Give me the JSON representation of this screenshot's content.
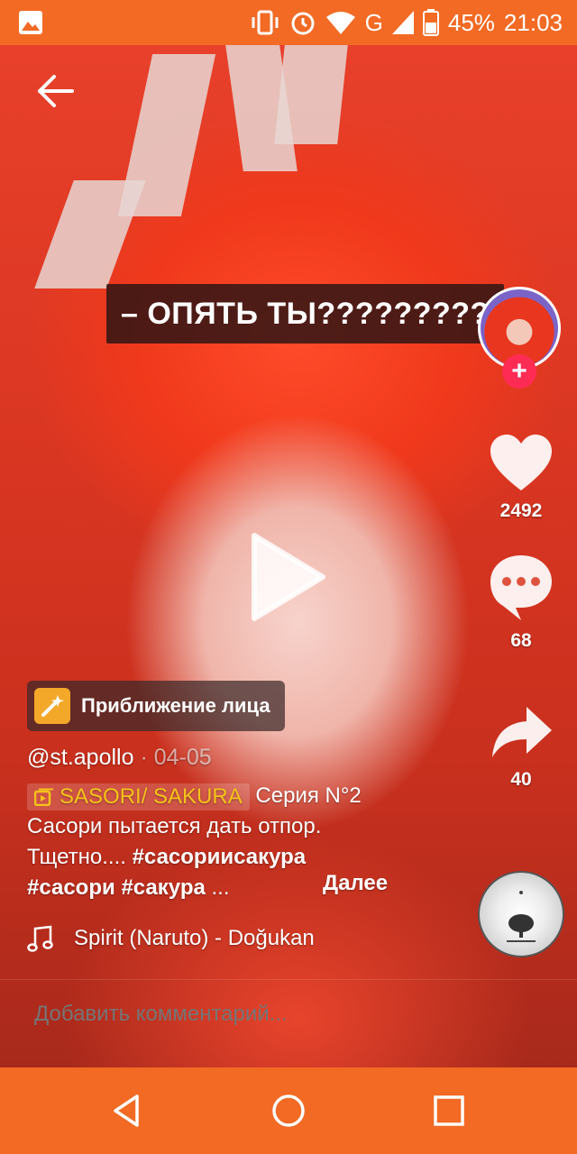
{
  "status_bar": {
    "battery": "45%",
    "time": "21:03",
    "network": "G",
    "icons": [
      "image-icon",
      "vibrate-icon",
      "alarm-icon",
      "wifi-icon",
      "signal-icon",
      "battery-icon"
    ]
  },
  "video": {
    "caption": "– ОПЯТЬ ТЫ?????????",
    "effect_label": "Приближение лица"
  },
  "actions": {
    "likes": "2492",
    "comments": "68",
    "shares": "40"
  },
  "post": {
    "username": "@st.apollo",
    "separator": " · ",
    "date": "04-05",
    "playlist": "SASORI/ SAKURA",
    "series": " Серия N°2",
    "text_line1": "Сасори пытается дать отпор.",
    "text_line2": "Тщетно.... ",
    "hashtag1": "#сасориисакура",
    "hashtag2": "#сасори",
    "hashtag3": "#сакура",
    "ellipsis": " ...",
    "more": "Далее"
  },
  "music": {
    "title": "Spirit (Naruto) - Doğukan"
  },
  "comment": {
    "placeholder": "Добавить комментарий..."
  },
  "colors": {
    "status_bar": "#f26a24",
    "follow": "#fe2c55",
    "playlist_text": "#f5c21b"
  }
}
